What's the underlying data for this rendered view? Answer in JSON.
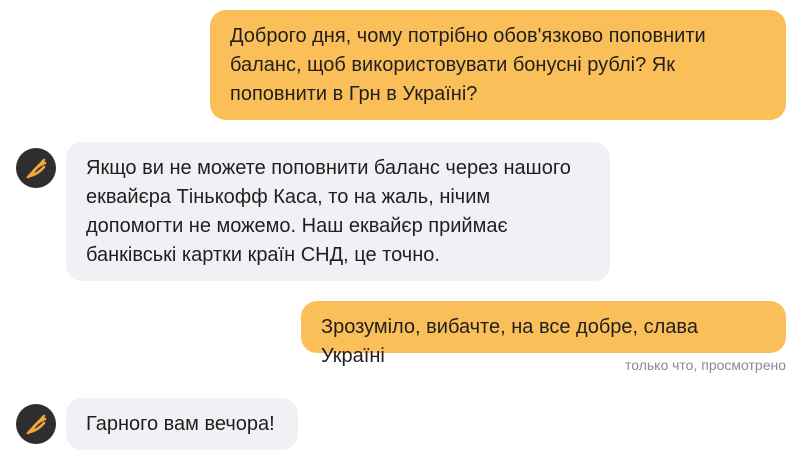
{
  "messages": [
    {
      "sender": "user",
      "text": "Доброго дня, чому потрібно обов'язково поповнити\nбаланс, щоб використовувати бонусні рублі? Як\nпоповнити в Грн в Україні?"
    },
    {
      "sender": "bot",
      "text": "Якщо ви не можете поповнити баланс через нашого\nеквайєра Тінькофф Каса, то на жаль, нічим\nдопомогти не можемо. Наш еквайєр приймає\nбанківські картки країн СНД, це точно."
    },
    {
      "sender": "user",
      "text": "Зрозуміло, вибачте, на все добре, слава Україні"
    },
    {
      "sender": "bot",
      "text": "Гарного вам вечора!"
    }
  ],
  "status_text": "только что, просмотрено",
  "colors": {
    "outgoing_bubble": "#fbbf59",
    "incoming_bubble": "#f0f1f4",
    "avatar_bg": "#2e2e2e",
    "avatar_logo": "#f2a93b",
    "status_text": "#8a8a8a"
  },
  "icons": {
    "bot_avatar": "feather-logo-icon"
  }
}
